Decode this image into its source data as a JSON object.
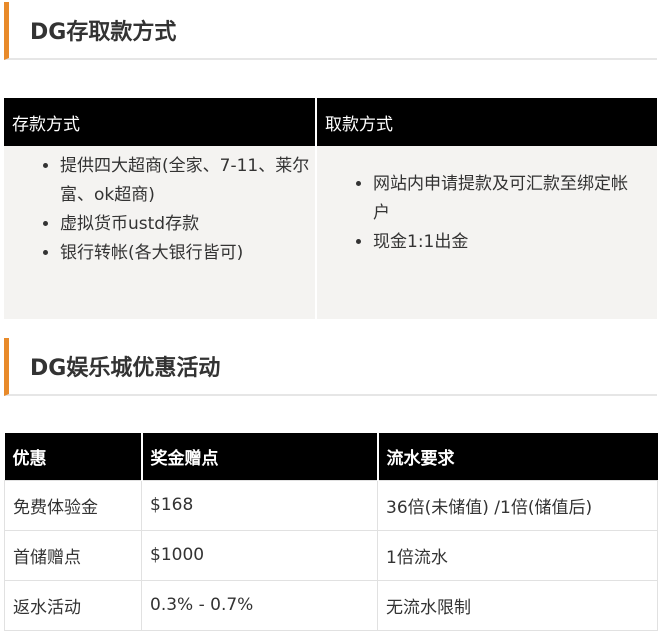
{
  "deposit_section": {
    "heading": "DG存取款方式",
    "deposit_header": "存款方式",
    "withdraw_header": "取款方式",
    "deposit_items": [
      "提供四大超商(全家、7-11、莱尔富、ok超商)",
      "虚拟货币ustd存款",
      "银行转帐(各大银行皆可)"
    ],
    "withdraw_items": [
      "网站内申请提款及可汇款至绑定帐户",
      "现金1:1出金"
    ]
  },
  "promo_section": {
    "heading": "DG娱乐城优惠活动",
    "columns": [
      "优惠",
      "奖金赠点",
      "流水要求"
    ],
    "rows": [
      [
        "免费体验金",
        "$168",
        "36倍(未储值) /1倍(储值后)"
      ],
      [
        "首储赠点",
        "$1000",
        "1倍流水"
      ],
      [
        "返水活动",
        "0.3% - 0.7%",
        "无流水限制"
      ]
    ]
  },
  "colors": {
    "accent": "#e88a2a",
    "header_bg": "#000000",
    "cell_bg": "#f4f3f1",
    "text": "#333333"
  }
}
